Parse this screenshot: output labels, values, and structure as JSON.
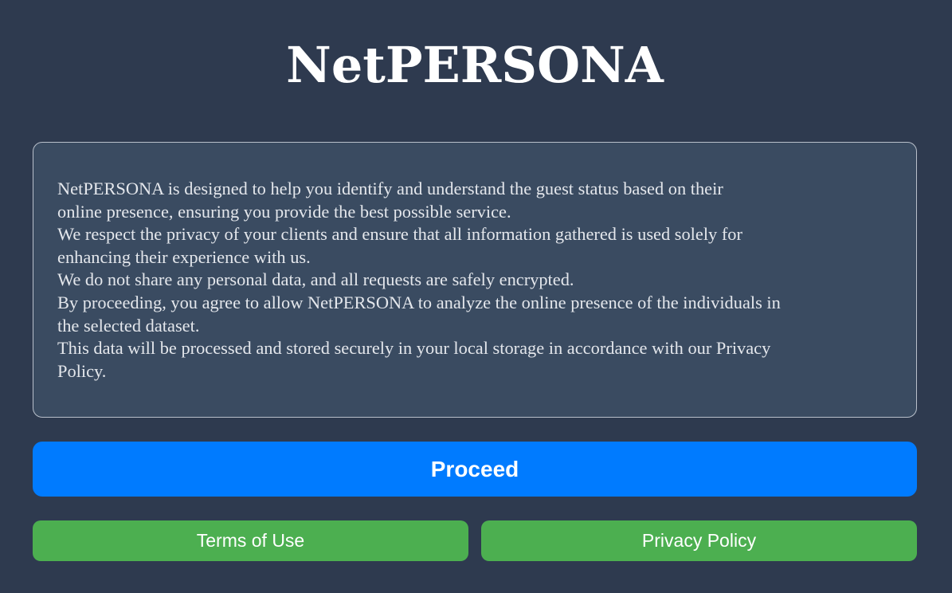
{
  "header": {
    "title": "NetPERSONA"
  },
  "info": {
    "lines": [
      "NetPERSONA is designed to help you identify and understand the guest status based on their",
      "online presence, ensuring you provide the best possible service.",
      "We respect the privacy of your clients and ensure that all information gathered is used solely for",
      "enhancing their experience with us.",
      "We do not share any personal data, and all requests are safely encrypted.",
      "By proceeding, you agree to allow NetPERSONA to analyze the online presence of the individuals in",
      "the selected dataset.",
      "This data will be processed and stored securely in your local storage in accordance with our Privacy",
      "Policy."
    ]
  },
  "actions": {
    "proceed_label": "Proceed",
    "terms_label": "Terms of Use",
    "privacy_label": "Privacy Policy"
  },
  "colors": {
    "background": "#2e3a4f",
    "panel": "#3a4b61",
    "primary": "#007bff",
    "secondary": "#4caf50"
  }
}
